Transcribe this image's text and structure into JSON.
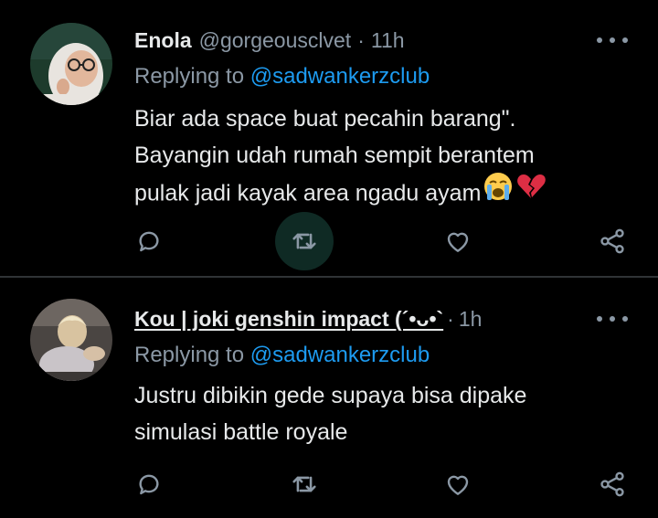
{
  "colors": {
    "background": "#000000",
    "text_primary": "#e7e9ea",
    "text_secondary": "#8b98a5",
    "link": "#1d9bf0",
    "divider": "#2f3336",
    "retweet_hover_bg": "#0f2a24"
  },
  "tweets": [
    {
      "display_name": "Enola",
      "handle": "@gorgeousclvet",
      "separator": "·",
      "time": "11h",
      "replying_prefix": "Replying to",
      "replying_to": "@sadwankerzclub",
      "text_lines": [
        "Biar ada space buat pecahin barang\".",
        "Bayangin udah rumah sempit berantem",
        "pulak jadi kayak area ngadu ayam"
      ],
      "emojis": [
        "loudly-crying-face-emoji",
        "broken-heart-emoji"
      ],
      "actions": [
        "reply-icon",
        "retweet-icon",
        "like-icon",
        "share-icon"
      ],
      "more_icon": "more-options-icon"
    },
    {
      "display_name": "Kou | joki genshin impact (´•ᴗ•`",
      "separator": "·",
      "time": "1h",
      "replying_prefix": "Replying to",
      "replying_to": "@sadwankerzclub",
      "text_lines": [
        "Justru dibikin gede supaya bisa dipake",
        "simulasi battle royale"
      ],
      "actions": [
        "reply-icon",
        "retweet-icon",
        "like-icon",
        "share-icon"
      ],
      "more_icon": "more-options-icon"
    }
  ]
}
